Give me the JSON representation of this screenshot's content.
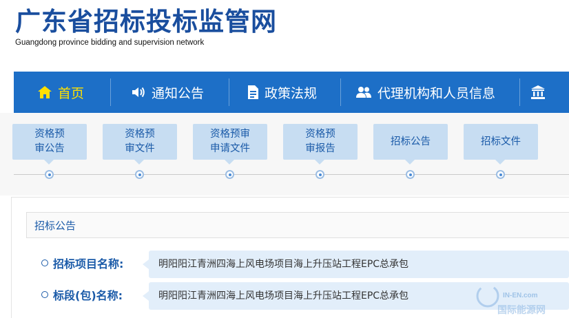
{
  "header": {
    "title": "广东省招标投标监管网",
    "subtitle": "Guangdong province bidding and supervision network"
  },
  "nav": {
    "items": [
      {
        "label": "首页",
        "icon": "home-icon",
        "active": true
      },
      {
        "label": "通知公告",
        "icon": "speaker-icon",
        "active": false
      },
      {
        "label": "政策法规",
        "icon": "document-icon",
        "active": false
      },
      {
        "label": "代理机构和人员信息",
        "icon": "users-icon",
        "active": false
      },
      {
        "label": "",
        "icon": "bank-icon",
        "active": false
      }
    ]
  },
  "steps": [
    {
      "label": "资格预\n审公告"
    },
    {
      "label": "资格预\n审文件"
    },
    {
      "label": "资格预审\n申请文件"
    },
    {
      "label": "资格预\n审报告"
    },
    {
      "label": "招标公告"
    },
    {
      "label": "招标文件"
    }
  ],
  "panel": {
    "title": "招标公告",
    "fields": [
      {
        "label": "招标项目名称:",
        "value": "明阳阳江青洲四海上风电场项目海上升压站工程EPC总承包"
      },
      {
        "label": "标段(包)名称:",
        "value": "明阳阳江青洲四海上风电场项目海上升压站工程EPC总承包"
      }
    ]
  },
  "watermark": {
    "brand": "IN-EN.com",
    "cn": "国际能源网"
  },
  "colors": {
    "brand_blue": "#1a4e9e",
    "nav_bg": "#1d6fc7",
    "nav_active": "#ffe000",
    "step_bg": "#c7ddf2",
    "field_bg": "#e2eefa"
  }
}
